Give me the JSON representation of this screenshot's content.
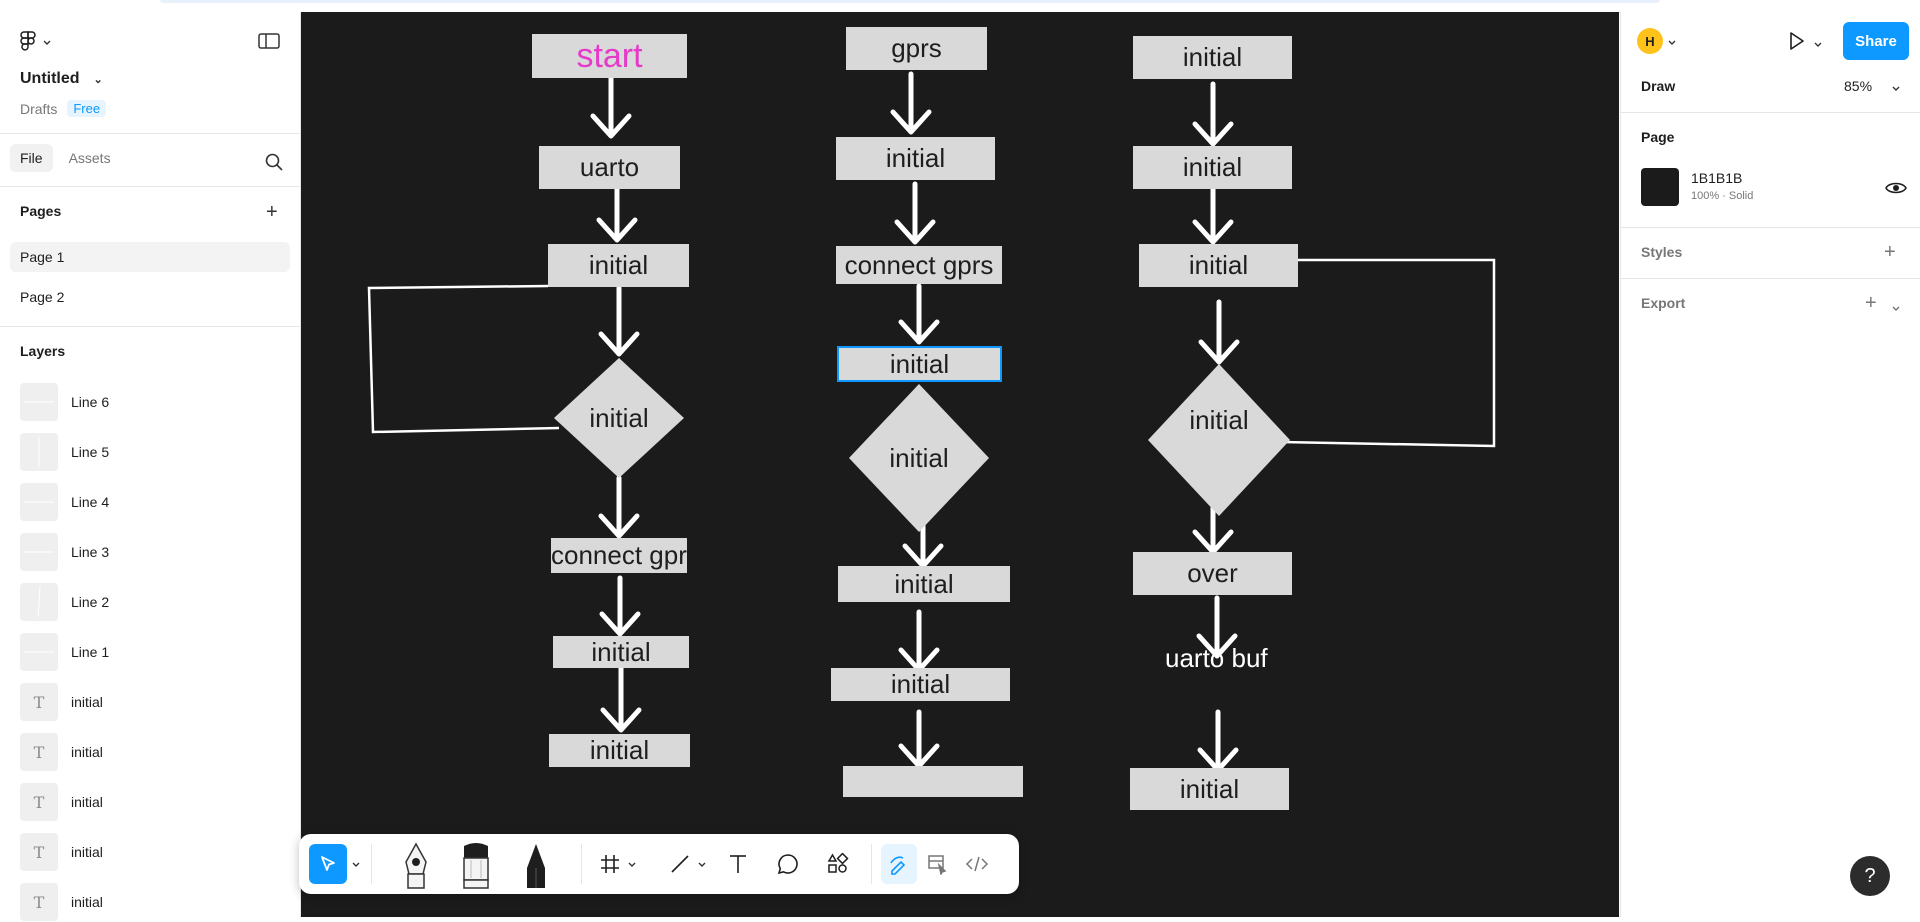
{
  "app": {
    "file_name": "Untitled",
    "location": "Drafts",
    "plan_badge": "Free"
  },
  "left_panel": {
    "tabs": [
      {
        "label": "File"
      },
      {
        "label": "Assets"
      }
    ],
    "pages_title": "Pages",
    "pages": [
      {
        "label": "Page 1"
      },
      {
        "label": "Page 2"
      }
    ],
    "layers_title": "Layers",
    "layers": [
      {
        "label": "Line 6",
        "icon": "line-thumbnail"
      },
      {
        "label": "Line 5",
        "icon": "line-thumbnail"
      },
      {
        "label": "Line 4",
        "icon": "line-thumbnail"
      },
      {
        "label": "Line 3",
        "icon": "line-thumbnail"
      },
      {
        "label": "Line 2",
        "icon": "line-thumbnail"
      },
      {
        "label": "Line 1",
        "icon": "line-thumbnail"
      },
      {
        "label": "initial",
        "icon": "text-thumbnail",
        "glyph": "T"
      },
      {
        "label": "initial",
        "icon": "text-thumbnail",
        "glyph": "T"
      },
      {
        "label": "initial",
        "icon": "text-thumbnail",
        "glyph": "T"
      },
      {
        "label": "initial",
        "icon": "text-thumbnail",
        "glyph": "T"
      },
      {
        "label": "initial",
        "icon": "text-thumbnail",
        "glyph": "T"
      }
    ]
  },
  "canvas": {
    "background": "#1B1B1B",
    "col1": {
      "start": "start",
      "uarto": "uarto",
      "initial1": "initial",
      "decision": "initial",
      "connect": "connect gprs",
      "initial2": "initial",
      "initial3": "initial"
    },
    "col2": {
      "gprs": "gprs",
      "initial1": "initial",
      "connect": "connect gprs",
      "initial_selected": "initial",
      "decision": "initial",
      "initial2": "initial",
      "initial3": "initial",
      "empty": ""
    },
    "col3": {
      "initial1": "initial",
      "initial2": "initial",
      "initial3": "initial",
      "decision": "initial",
      "over": "over",
      "uarto_buf": "uarto buf",
      "initial4": "initial"
    },
    "colors": {
      "start_text": "#E43BC8",
      "box_fill": "#D9D9D9",
      "selection": "#0D99FF"
    }
  },
  "right_panel": {
    "avatar_initial": "H",
    "share_label": "Share",
    "mode_label": "Draw",
    "zoom": "85%",
    "page_section": "Page",
    "bg_hex": "1B1B1B",
    "bg_meta": "100% · Solid",
    "styles_label": "Styles",
    "export_label": "Export"
  },
  "help_label": "?"
}
